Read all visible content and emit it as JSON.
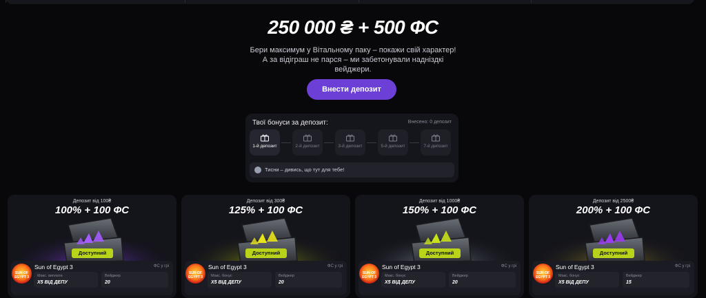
{
  "hero": {
    "title": "250 000 ₴ + 500 ФС",
    "subtitle": "Бери максимум у Вітальному паку – покажи свій характер! А за відіграш не парся – ми забетонували надніздкі вейджери.",
    "deposit_button": "Внести депозит"
  },
  "bonus_panel": {
    "heading": "Твої бонуси за депозит:",
    "used_label": "Внесено: 0 депозит",
    "steps": [
      {
        "label": "1-й депозит",
        "active": true,
        "icon": "gift-box-icon"
      },
      {
        "label": "2-й депозит",
        "active": false,
        "icon": "gift-box-icon"
      },
      {
        "label": "3-й депозит",
        "active": false,
        "icon": "gift-box-icon"
      },
      {
        "label": "5-й депозит",
        "active": false,
        "icon": "gift-box-icon"
      },
      {
        "label": "7-й депозит",
        "active": false,
        "icon": "gift-box-icon"
      }
    ],
    "hint": "Тисни – дивись, що тут для тебе!"
  },
  "cards": [
    {
      "min_deposit": "Депозит від 100₴",
      "offer": "100% + 100 ФС",
      "status": "Доступний",
      "game": "Sun of Egypt 3",
      "fs_badge": "ФС у грі",
      "field1_label": "Макс. виплата",
      "field1_value": "X5 ВІД ДЕПУ",
      "field2_label": "Вейджер",
      "field2_value": "20",
      "glow": "#7a3cd6",
      "gem": "#a45cff"
    },
    {
      "min_deposit": "Депозит від 300₴",
      "offer": "125% + 100 ФС",
      "status": "Доступний",
      "game": "Sun of Egypt 3",
      "fs_badge": "ФС у грі",
      "field1_label": "Макс. бонус",
      "field1_value": "X5 ВІД ДЕПУ",
      "field2_label": "Вейджер",
      "field2_value": "20",
      "glow": "#8c9a12",
      "gem": "#e8e21a"
    },
    {
      "min_deposit": "Депозит від 1000₴",
      "offer": "150% + 100 ФС",
      "status": "Доступний",
      "game": "Sun of Egypt 3",
      "fs_badge": "ФС у грі",
      "field1_label": "Макс. бонус",
      "field1_value": "X5 ВІД ДЕПУ",
      "field2_label": "Вейджер",
      "field2_value": "20",
      "glow": "#7b8590",
      "gem": "#c8e21a"
    },
    {
      "min_deposit": "Депозит від 2500₴",
      "offer": "200% + 100 ФС",
      "status": "Доступний",
      "game": "Sun of Egypt 3",
      "fs_badge": "ФС у грі",
      "field1_label": "Макс. бонус",
      "field1_value": "X5 ВІД ДЕПУ",
      "field2_label": "Вейджер",
      "field2_value": "15",
      "glow": "#8a7a2a",
      "gem": "#9a3cf0"
    }
  ],
  "colors": {
    "accent": "#6c3fd6",
    "available": "#b9d21a",
    "panel": "#15151c",
    "background": "#08080a"
  },
  "game_logo_text": "SUN OF EGYPT 3"
}
